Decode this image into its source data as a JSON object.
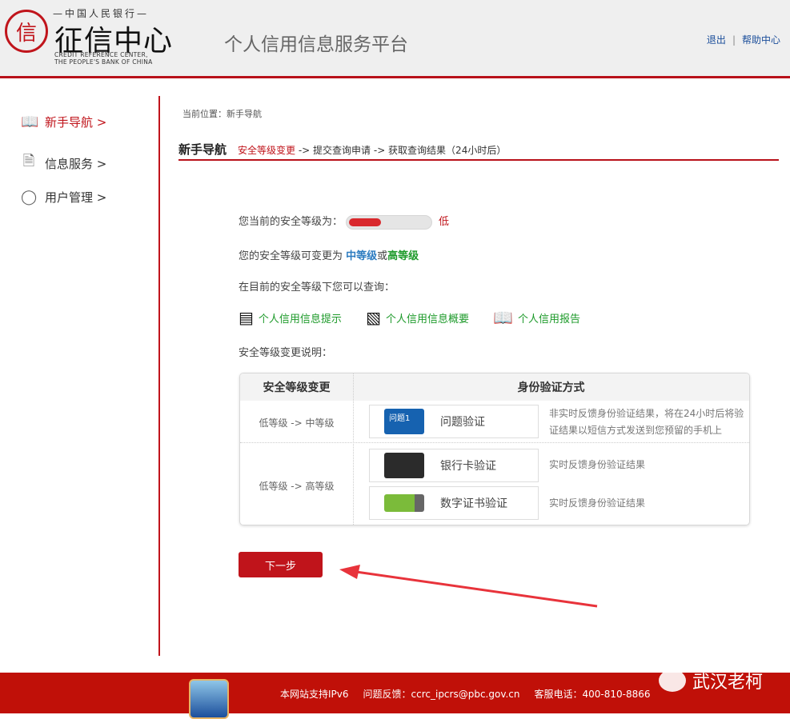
{
  "header": {
    "logo_top": "—中国人民银行—",
    "logo_main": "征信中心",
    "logo_seal": "信",
    "logo_en": [
      "CREDIT REFERENCE CENTER,",
      "THE PEOPLE'S BANK OF CHINA"
    ],
    "platform_title": "个人信用信息服务平台",
    "logout": "退出",
    "separator": "|",
    "help": "帮助中心"
  },
  "sidebar": {
    "items": [
      {
        "label": "新手导航 >",
        "icon": "book-icon"
      },
      {
        "label": "信息服务 >",
        "icon": "document-icon"
      },
      {
        "label": "用户管理 >",
        "icon": "user-icon"
      }
    ]
  },
  "breadcrumb": "当前位置：新手导航",
  "section": {
    "title": "新手导航",
    "step1": "安全等级变更",
    "step2": " -> 提交查询申请 -> 获取查询结果（24小时后）"
  },
  "security": {
    "current_label": "您当前的安全等级为：",
    "level": "低",
    "level_fraction": 0.4,
    "change_prefix": "您的安全等级可变更为 ",
    "medium": "中等级",
    "or": "或",
    "high": "高等级",
    "query_label": "在目前的安全等级下您可以查询：",
    "links": [
      "个人信用信息提示",
      "个人信用信息概要",
      "个人信用报告"
    ],
    "explain_label": "安全等级变更说明："
  },
  "table": {
    "headers": [
      "安全等级变更",
      "身份验证方式"
    ],
    "rows": [
      {
        "level": "低等级 -> 中等级"
      },
      {
        "level": "低等级 -> 高等级"
      }
    ],
    "methods": [
      {
        "name": "问题验证",
        "pic_text": "问题1",
        "desc": "非实时反馈身份验证结果，将在24小时后将验证结果以短信方式发送到您预留的手机上"
      },
      {
        "name": "银行卡验证",
        "desc": "实时反馈身份验证结果"
      },
      {
        "name": "数字证书验证",
        "desc": "实时反馈身份验证结果"
      }
    ]
  },
  "next_button": "下一步",
  "footer": {
    "ipv6": "本网站支持IPv6",
    "feedback": "问题反馈：ccrc_ipcrs@pbc.gov.cn",
    "phone": "客服电话：400-810-8866",
    "watermark": "武汉老柯"
  },
  "colors": {
    "brand_red": "#c0141b",
    "medium_blue": "#2b7bc0",
    "link_green": "#1d9a2a"
  }
}
